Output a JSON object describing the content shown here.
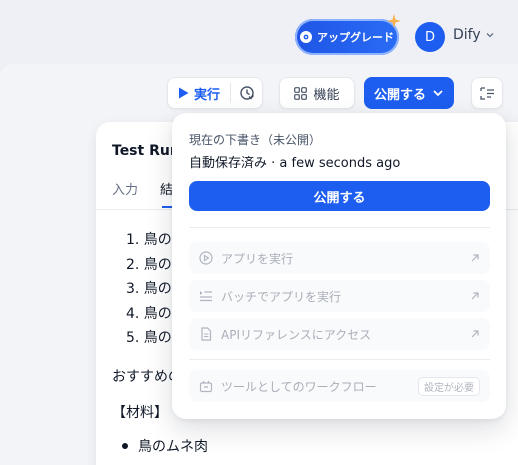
{
  "header": {
    "upgrade_label": "アップグレード",
    "avatar_initial": "D",
    "workspace_name": "Dify"
  },
  "toolbar": {
    "run_label": "実行",
    "features_label": "機能",
    "publish_label": "公開する"
  },
  "test_panel": {
    "title": "Test Run",
    "tabs": [
      {
        "label": "入力"
      },
      {
        "label": "結果"
      }
    ],
    "list_items": [
      "1. 鳥の",
      "2. 鳥の",
      "3. 鳥の",
      "4. 鳥の",
      "5. 鳥の"
    ],
    "line_recommend": "おすすめの",
    "materials_heading": "【材料】",
    "bullet_item": "鳥のムネ肉"
  },
  "publish_menu": {
    "draft_label": "現在の下書き（未公開）",
    "autosave_status": "自動保存済み · a few seconds ago",
    "publish_button": "公開する",
    "items": [
      {
        "label": "アプリを実行"
      },
      {
        "label": "バッチでアプリを実行"
      },
      {
        "label": "APIリファレンスにアクセス"
      }
    ],
    "tool_item": {
      "label": "ツールとしてのワークフロー",
      "badge": "設定が必要"
    }
  },
  "colors": {
    "accent": "#1d5ef0",
    "background": "#eef0f5",
    "disabled_text": "#a9aeb8"
  }
}
